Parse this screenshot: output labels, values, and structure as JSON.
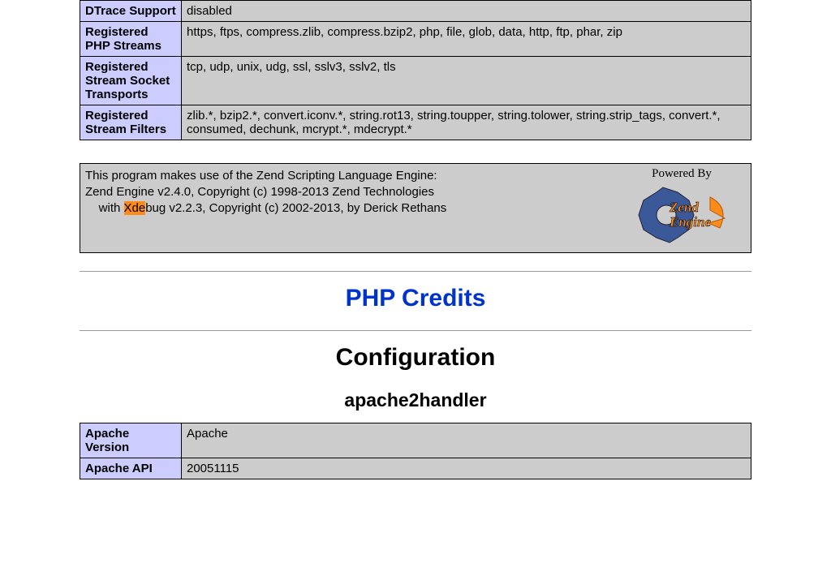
{
  "info_rows": [
    {
      "label": "DTrace Support",
      "value": "disabled"
    },
    {
      "label": "Registered PHP Streams",
      "value": "https, ftps, compress.zlib, compress.bzip2, php, file, glob, data, http, ftp, phar, zip"
    },
    {
      "label": "Registered Stream Socket Transports",
      "value": "tcp, udp, unix, udg, ssl, sslv3, sslv2, tls"
    },
    {
      "label": "Registered Stream Filters",
      "value": "zlib.*, bzip2.*, convert.iconv.*, string.rot13, string.toupper, string.tolower, string.strip_tags, convert.*, consumed, dechunk, mcrypt.*, mdecrypt.*"
    }
  ],
  "zend": {
    "line1": "This program makes use of the Zend Scripting Language Engine:",
    "line2": "Zend Engine v2.4.0, Copyright (c) 1998-2013 Zend Technologies",
    "line3_prefix": "    with ",
    "line3_hl": "Xde",
    "line3_rest": "bug v2.2.3, Copyright (c) 2002-2013, by Derick Rethans",
    "powered_by": "Powered By",
    "logo_text1": "Zend",
    "logo_text2": "Engine"
  },
  "headings": {
    "credits": "PHP Credits",
    "configuration": "Configuration",
    "module": "apache2handler"
  },
  "apache_rows": [
    {
      "label": "Apache Version",
      "value": "Apache"
    },
    {
      "label": "Apache API",
      "value": "20051115"
    }
  ]
}
